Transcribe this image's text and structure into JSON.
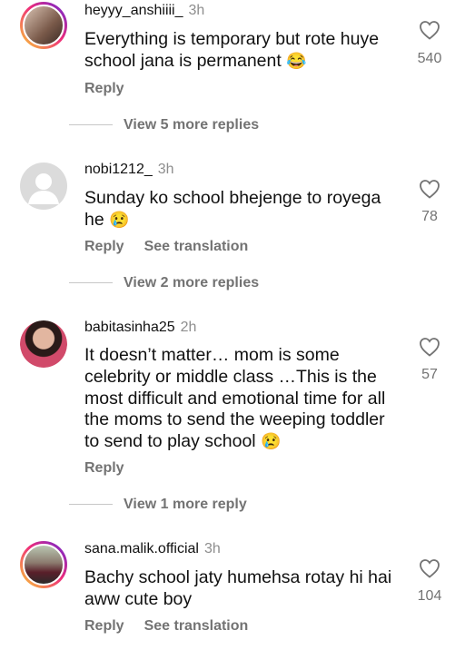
{
  "comments": [
    {
      "username": "heyyy_anshiiii_",
      "time": "3h",
      "text": "Everything is temporary but rote huye school jana is permanent",
      "emoji": "😂",
      "likes": "540",
      "reply": "Reply",
      "view_replies": "View 5 more replies"
    },
    {
      "username": "nobi1212_",
      "time": "3h",
      "text": "Sunday ko school bhejenge to royega he",
      "emoji": "😢",
      "likes": "78",
      "reply": "Reply",
      "translate": "See translation",
      "view_replies": "View 2 more replies"
    },
    {
      "username": "babitasinha25",
      "time": "2h",
      "text": "It doesn’t matter… mom is some celebrity or middle class …This is the most difficult and emotional time for all the moms to send the weeping toddler to send to play school",
      "emoji": "😢",
      "likes": "57",
      "reply": "Reply",
      "view_replies": "View 1 more reply"
    },
    {
      "username": "sana.malik.official",
      "time": "3h",
      "text": "Bachy school jaty humehsa rotay hi hai aww cute boy",
      "likes": "104",
      "reply": "Reply",
      "translate": "See translation"
    }
  ],
  "colors": {
    "secondary": "#737373",
    "story_ring": "#ee2a7b"
  },
  "icons": {
    "like": "heart-outline-icon",
    "default_avatar": "default-avatar-icon"
  }
}
